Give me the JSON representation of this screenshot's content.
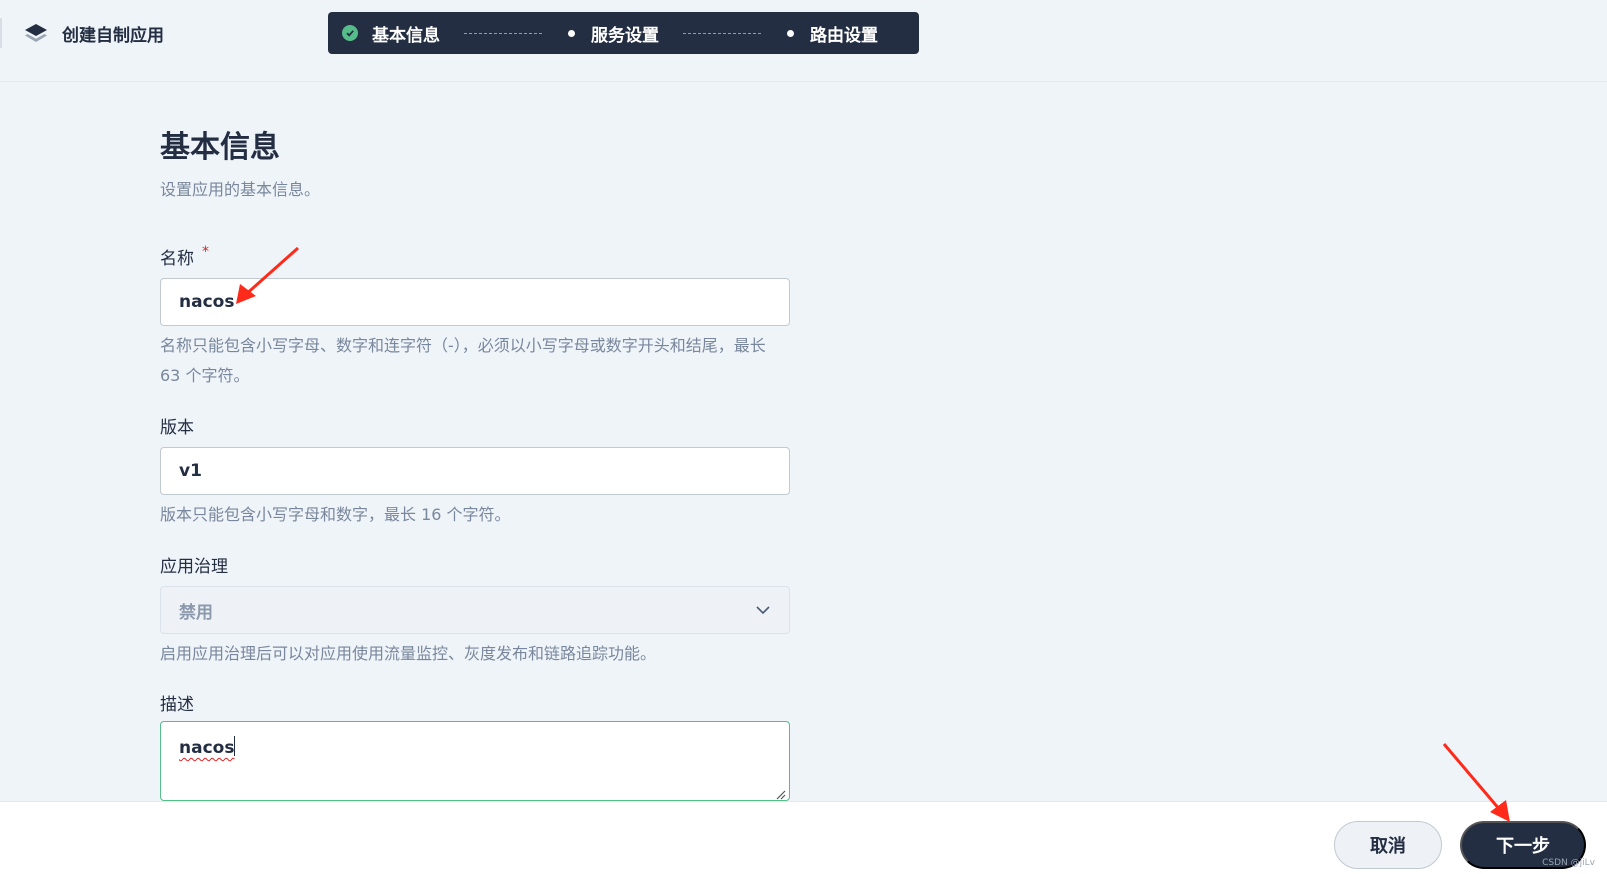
{
  "header": {
    "title": "创建自制应用",
    "steps": [
      {
        "label": "基本信息",
        "state": "done"
      },
      {
        "label": "服务设置",
        "state": "pending"
      },
      {
        "label": "路由设置",
        "state": "pending"
      }
    ]
  },
  "section": {
    "title": "基本信息",
    "description": "设置应用的基本信息。"
  },
  "form": {
    "name": {
      "label": "名称",
      "required_mark": "*",
      "value": "nacos",
      "hint": "名称只能包含小写字母、数字和连字符（-），必须以小写字母或数字开头和结尾，最长 63 个字符。"
    },
    "version": {
      "label": "版本",
      "value": "v1",
      "hint": "版本只能包含小写字母和数字，最长 16 个字符。"
    },
    "governance": {
      "label": "应用治理",
      "selected": "禁用",
      "hint": "启用应用治理后可以对应用使用流量监控、灰度发布和链路追踪功能。"
    },
    "description": {
      "label": "描述",
      "value": "nacos"
    }
  },
  "footer": {
    "cancel_label": "取消",
    "next_label": "下一步",
    "watermark": "CSDN @jiLv"
  },
  "colors": {
    "primary_dark": "#242e42",
    "success_green": "#55bc8a",
    "required_red": "#ca2621",
    "annotation_red": "#ff2a1a"
  },
  "icons": {
    "logo": "layers-icon",
    "step_done": "check-circle-icon",
    "select": "chevron-down-icon"
  }
}
